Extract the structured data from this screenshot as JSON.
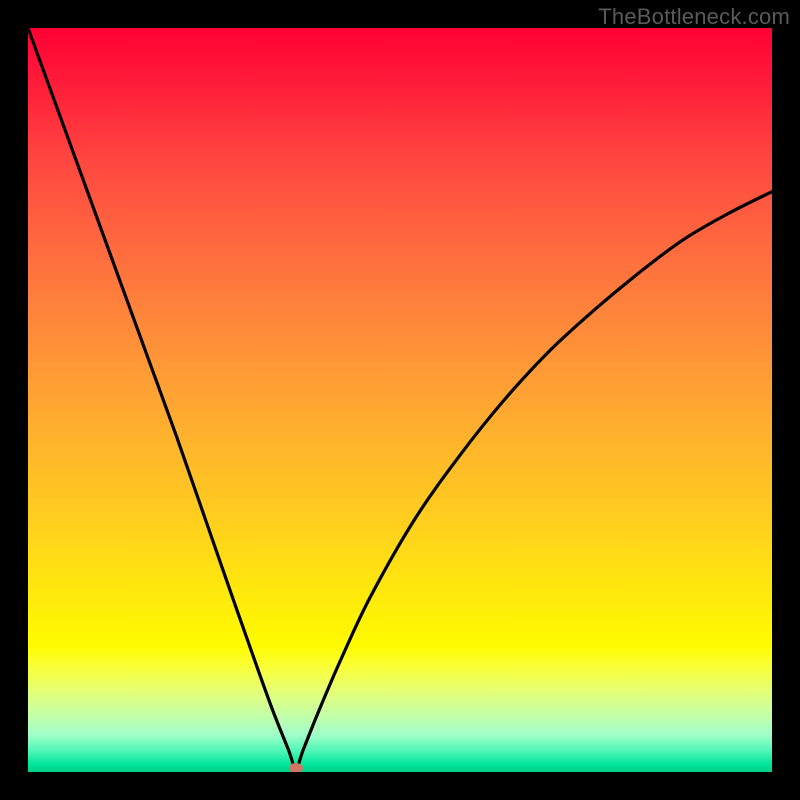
{
  "watermark": "TheBottleneck.com",
  "colors": {
    "curve": "#000000",
    "dot": "#cf7564",
    "frame_bg": "#000000"
  },
  "chart_data": {
    "type": "line",
    "title": "",
    "xlabel": "",
    "ylabel": "",
    "xlim": [
      0,
      100
    ],
    "ylim": [
      0,
      100
    ],
    "grid": false,
    "legend": false,
    "annotations": [],
    "description": "Absolute-difference bottleneck curve over a red-to-green vertical gradient. The curve descends steeply from the top-left, reaches a minimum near x≈36 at the bottom edge, then rises with decreasing slope toward the right edge at about y≈78. A small reddish dot marks the minimum.",
    "series": [
      {
        "name": "bottleneck-curve",
        "x": [
          0,
          4,
          8,
          12,
          16,
          20,
          24,
          28,
          31,
          33,
          35,
          36,
          37,
          39,
          42,
          46,
          52,
          58,
          64,
          70,
          76,
          82,
          88,
          94,
          100
        ],
        "y": [
          100,
          89,
          78,
          67,
          56,
          45,
          33.5,
          22,
          13.5,
          8,
          3,
          0.5,
          3,
          8,
          15,
          23.5,
          34,
          42.5,
          50,
          56.5,
          62,
          67,
          71.5,
          75,
          78
        ]
      }
    ],
    "minimum_point": {
      "x": 36,
      "y": 0.5
    }
  }
}
